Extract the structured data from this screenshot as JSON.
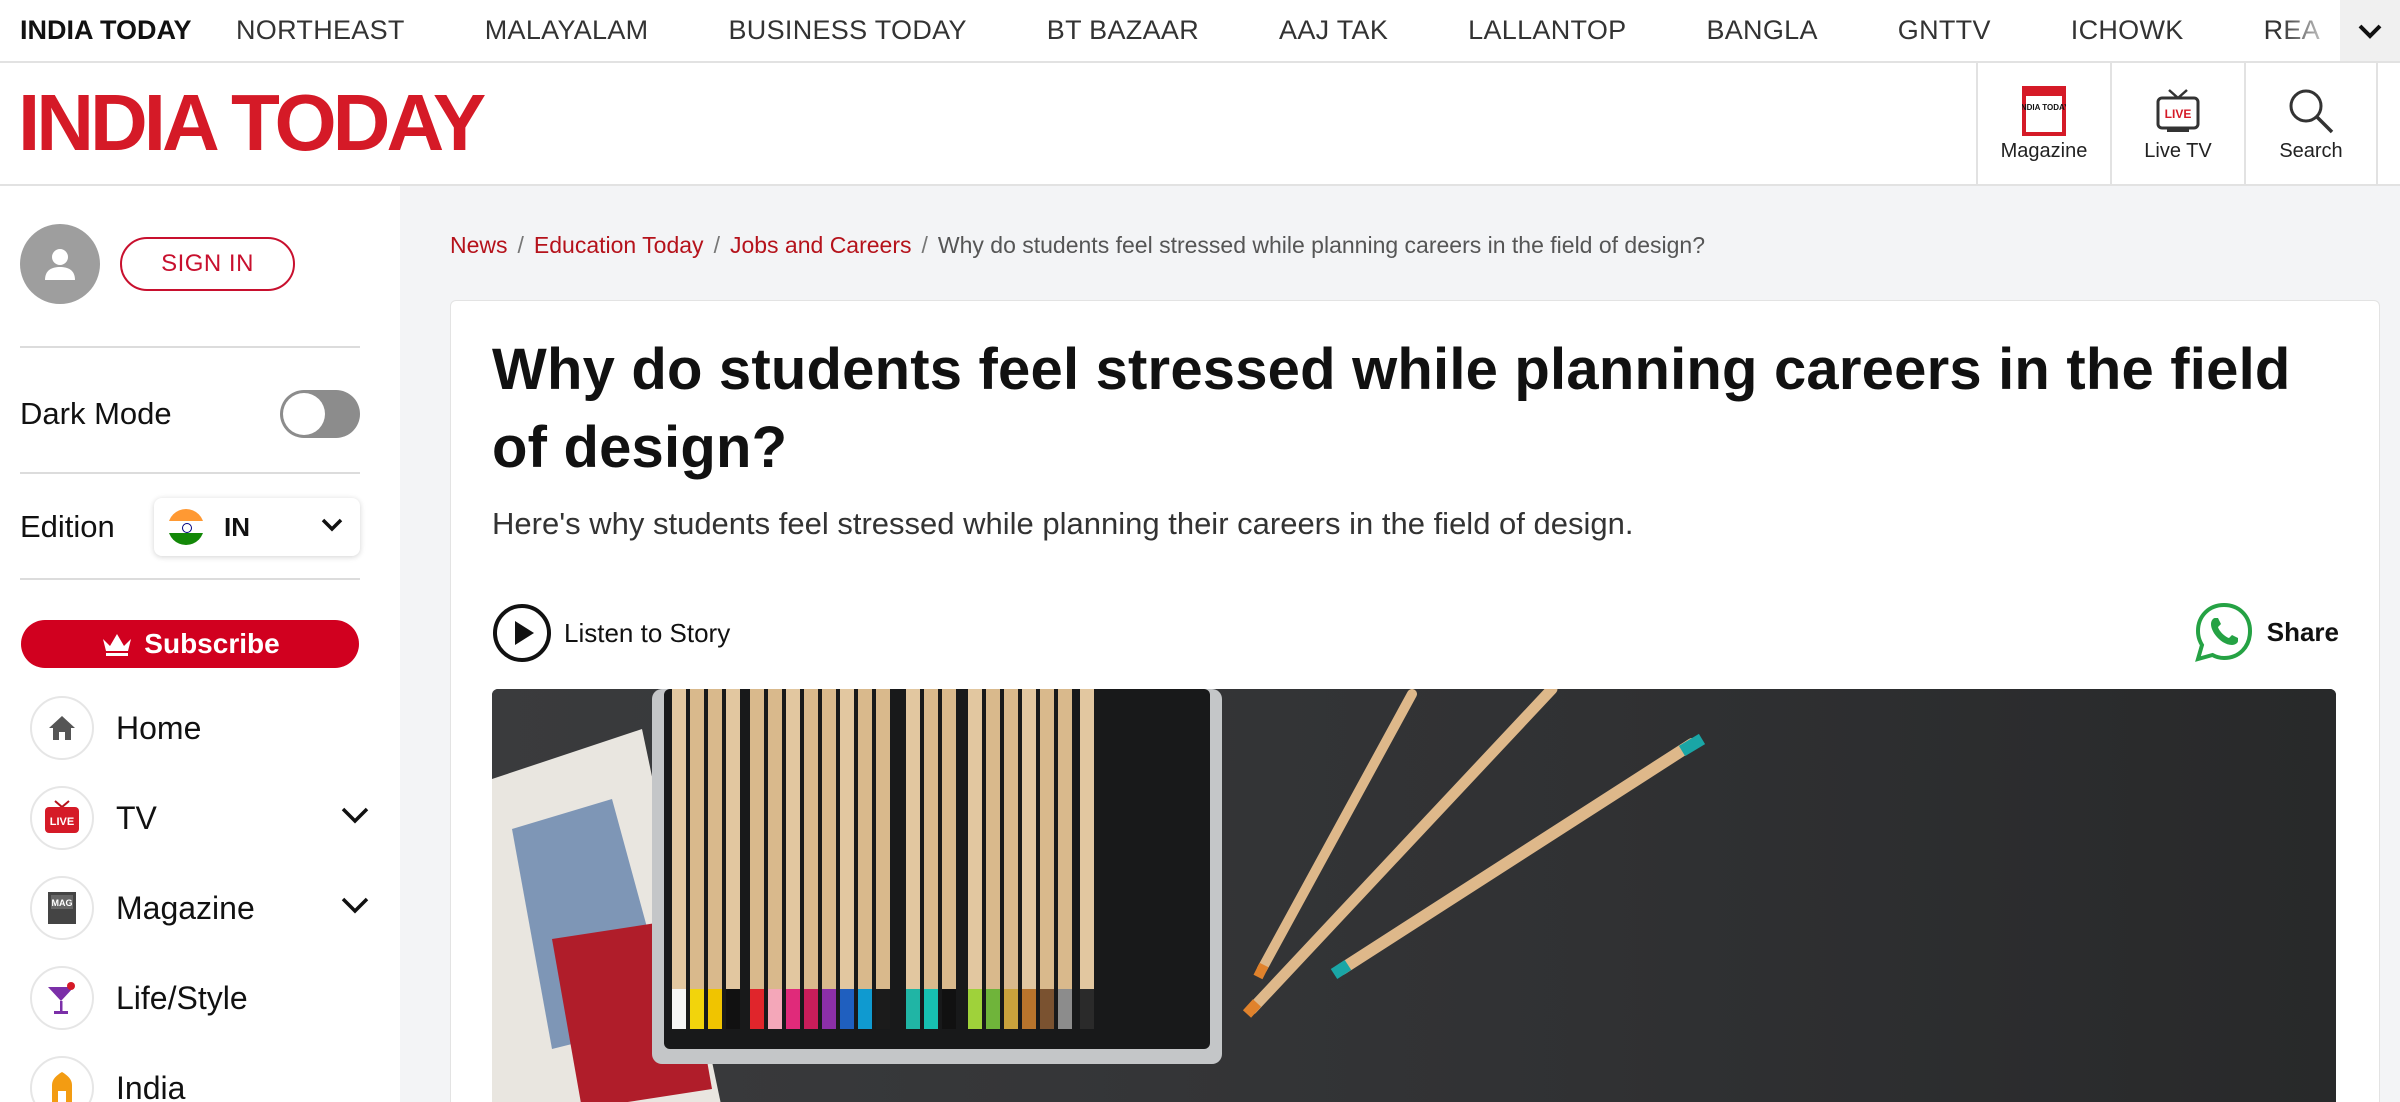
{
  "topbar": {
    "brand": "INDIA TODAY",
    "links": [
      "NORTHEAST",
      "MALAYALAM",
      "BUSINESS TODAY",
      "BT BAZAAR",
      "AAJ TAK",
      "LALLANTOP",
      "BANGLA",
      "GNTTV",
      "ICHOWK",
      "REA"
    ]
  },
  "header": {
    "logo": "INDIA TODAY",
    "tools": {
      "magazine": "Magazine",
      "livetv": "Live TV",
      "search": "Search"
    },
    "magazine_icon_text": "INDIA TODAY",
    "livetv_icon_text": "LIVE"
  },
  "sidebar": {
    "signin": "SIGN IN",
    "dark_mode": "Dark Mode",
    "edition_label": "Edition",
    "edition_code": "IN",
    "subscribe": "Subscribe",
    "nav": [
      {
        "label": "Home",
        "icon": "home-icon"
      },
      {
        "label": "TV",
        "icon": "live-tv-icon",
        "icon_text": "LIVE"
      },
      {
        "label": "Magazine",
        "icon": "magazine-icon",
        "icon_text": "MAG"
      },
      {
        "label": "Life/Style",
        "icon": "cocktail-icon"
      },
      {
        "label": "India",
        "icon": "india-icon"
      }
    ]
  },
  "breadcrumb": {
    "items": [
      "News",
      "Education Today",
      "Jobs and Careers"
    ],
    "current": "Why do students feel stressed while planning careers in the field of design?"
  },
  "article": {
    "title": "Why do students feel stressed while planning careers in the field of design?",
    "subtitle": "Here's why students feel stressed while planning their careers in the field of design.",
    "listen": "Listen to Story",
    "share": "Share"
  },
  "colors": {
    "brand_red": "#d51a27",
    "link_red": "#b5121b",
    "subscribe_red": "#d1001f",
    "whatsapp_green": "#25a244"
  }
}
